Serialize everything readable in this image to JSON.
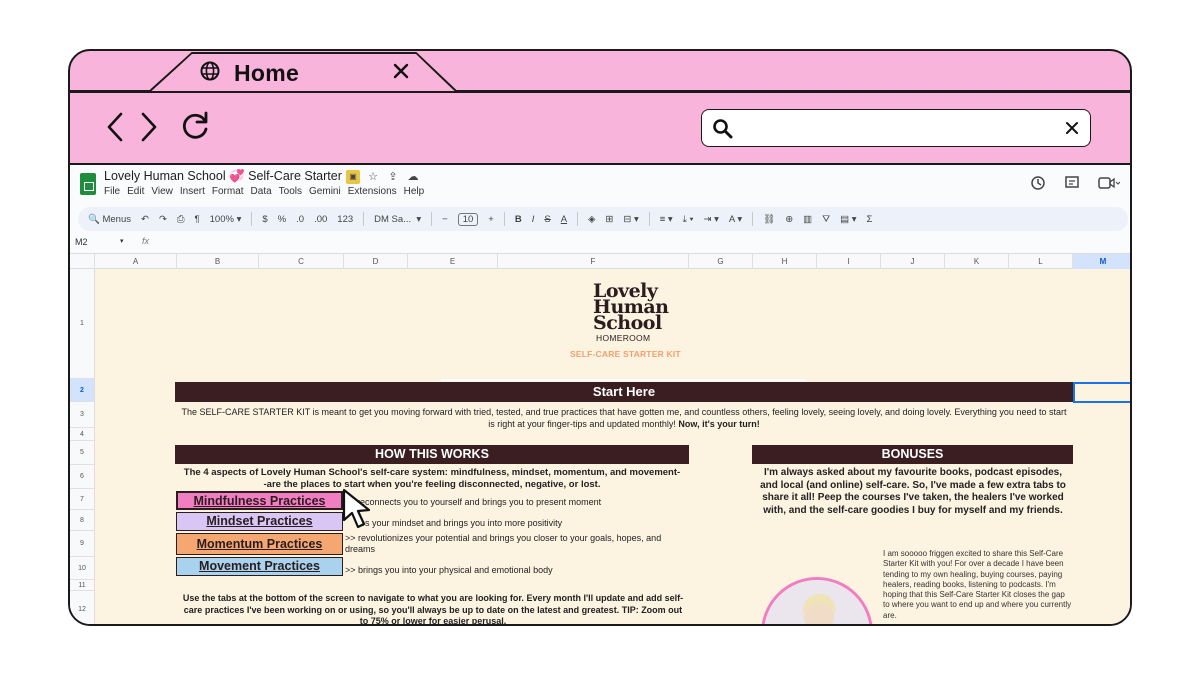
{
  "browser": {
    "tab_title": "Home",
    "icons": {
      "globe": "globe-icon",
      "close": "close-icon",
      "back": "back-icon",
      "forward": "forward-icon",
      "reload": "reload-icon",
      "search": "search-icon",
      "clear": "clear-icon"
    },
    "address_value": ""
  },
  "sheets": {
    "doc_title": "Lovely Human School 💞 Self-Care Starter Kit",
    "menu": [
      "File",
      "Edit",
      "View",
      "Insert",
      "Format",
      "Data",
      "Tools",
      "Gemini",
      "Extensions",
      "Help"
    ],
    "toolbar": {
      "menus": "Menus",
      "zoom": "100%",
      "currency": "$",
      "percent": "%",
      "dec_less": ".0",
      "dec_more": ".00",
      "number_format": "123",
      "font": "DM Sa...",
      "font_size": "10",
      "minus": "−",
      "plus": "+",
      "bold": "B",
      "italic": "I",
      "strike": "S",
      "text_color": "A",
      "sum": "Σ"
    },
    "cell_ref": "M2",
    "fx": "fx",
    "columns": [
      "A",
      "B",
      "C",
      "D",
      "E",
      "F",
      "G",
      "H",
      "I",
      "J",
      "K",
      "L",
      "M"
    ],
    "selected_column": "M",
    "rows": [
      "1",
      "2",
      "3",
      "4",
      "5",
      "6",
      "7",
      "8",
      "9",
      "10",
      "11",
      "12"
    ],
    "selected_row": "2"
  },
  "content": {
    "brand": {
      "line1": "Lovely",
      "line2": "Human",
      "line3": "School",
      "sub": "HOMEROOM",
      "kit": "SELF-CARE STARTER KIT"
    },
    "start_here": "Start Here",
    "intro_text": "The SELF-CARE STARTER KIT is meant to get you moving forward with tried, tested, and true practices that have gotten me, and countless others, feeling lovely, seeing lovely, and doing lovely. Everything you need to start is right at your finger-tips and updated monthly!",
    "intro_bold": "Now, it's your turn!",
    "how_title": "HOW THIS WORKS",
    "aspects_text": "The 4 aspects of Lovely Human School's self-care system: mindfulness, mindset, momentum, and movement--are the places to start when you're feeling disconnected, negative, or lost.",
    "practices": [
      {
        "label": "Mindfulness Practices",
        "desc": "reconnects you to yourself and brings you to present moment"
      },
      {
        "label": "Mindset Practices",
        "desc": "res your mindset and brings you into more positivity"
      },
      {
        "label": "Momentum Practices",
        "desc": ">> revolutionizes your potential and brings you closer to your goals, hopes, and dreams"
      },
      {
        "label": "Movement Practices",
        "desc": ">> brings you into your physical and emotional body"
      }
    ],
    "tabs_note": "Use the tabs at the bottom of the screen to navigate to what you are looking for. Every month I'll update and add self-care practices I've been working on or using, so you'll always be up to date on the latest and greatest. TIP: Zoom out to 75% or lower for easier perusal.",
    "bonuses_title": "BONUSES",
    "bonuses_text": "I'm always asked about my favourite books, podcast episodes, and local (and online) self-care. So, I've made a few extra tabs to share it all! Peep the courses I've taken, the healers I've worked with, and the self-care goodies I buy for myself and my friends.",
    "bonus_blurb": "I am sooooo friggen excited to share this Self-Care Starter Kit with you! For over a decade I have been tending to my own healing, buying courses, paying healers, reading books, listening to podcasts. I'm hoping that this Self-Care Starter Kit closes the gap to where you want to end up and where you currently are."
  },
  "colors": {
    "browser_pink": "#f8b4db",
    "sheet_bg": "#fdf3e1",
    "banner_dark": "#3a1e22",
    "mindfulness": "#f27ec2",
    "mindset": "#d9c6f5",
    "momentum": "#f5a772",
    "movement": "#a8d2ee",
    "kit_orange": "#f0a070",
    "selection_blue": "#1a73e8"
  }
}
